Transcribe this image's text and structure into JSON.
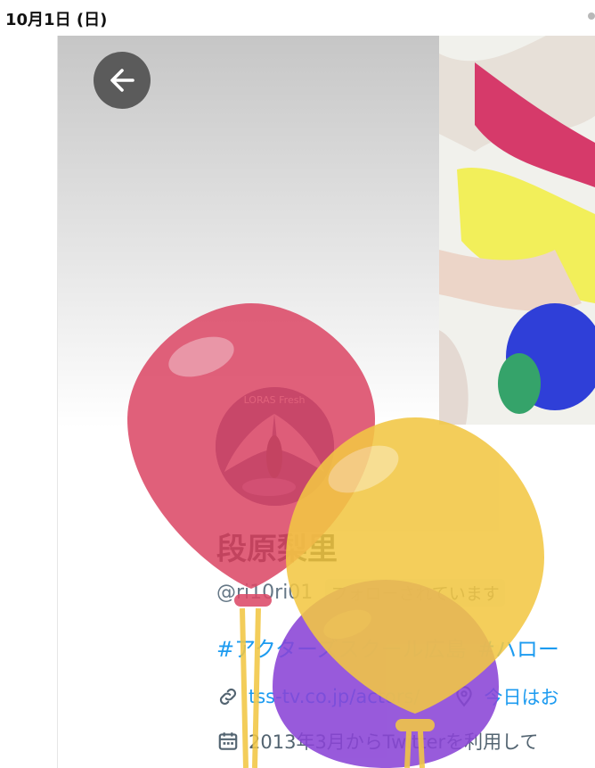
{
  "status_bar": {
    "date": "10月1日 (日)"
  },
  "header": {
    "back_label": "Back"
  },
  "profile": {
    "display_name": "段原梨里",
    "handle": "@ri10ri01",
    "follows_you": "フォローされています",
    "hashtags": [
      "#アクターズスクール広島",
      "#ハロー"
    ],
    "link": "tss-tv.co.jp/actors/",
    "location": "今日はお",
    "joined": "2013年3月からTwitterを利用して"
  },
  "avatar_text": "LORAS Fresh",
  "colors": {
    "accent": "#1d9bf0",
    "balloon_red": "#dc4a68",
    "balloon_yellow": "#f2c744",
    "balloon_purple": "#8a44d6"
  }
}
